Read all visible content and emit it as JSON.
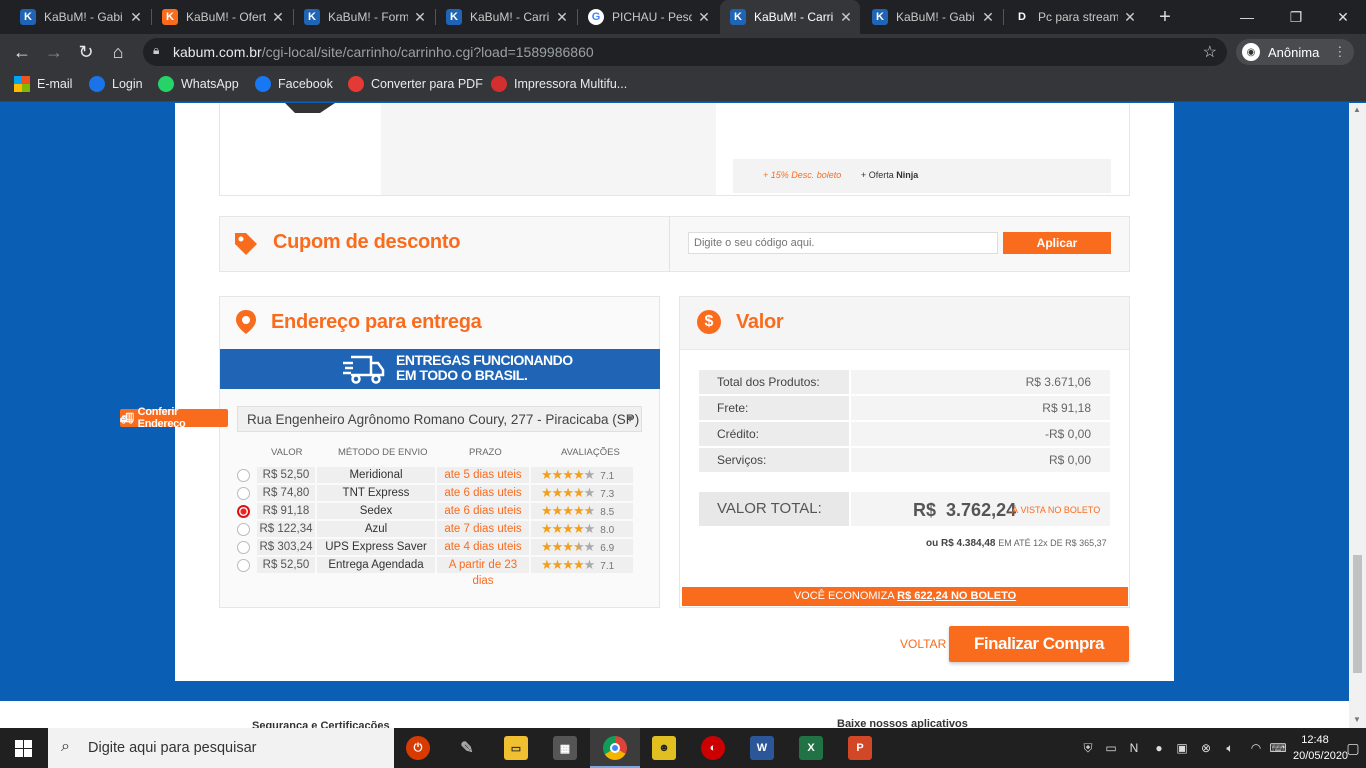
{
  "browser": {
    "tabs": [
      {
        "title": "KaBuM! - Gabi",
        "icon": "kabum-icon",
        "active": false
      },
      {
        "title": "KaBuM! - Ofert",
        "icon": "kabum-offer-icon",
        "active": false
      },
      {
        "title": "KaBuM! - Form",
        "icon": "kabum-icon",
        "active": false
      },
      {
        "title": "KaBuM! - Carri",
        "icon": "kabum-icon",
        "active": false
      },
      {
        "title": "PICHAU - Pesq",
        "icon": "google-icon",
        "active": false
      },
      {
        "title": "KaBuM! - Carri",
        "icon": "kabum-icon",
        "active": true
      },
      {
        "title": "KaBuM! - Gabi",
        "icon": "kabum-icon",
        "active": false
      },
      {
        "title": "Pc para stream",
        "icon": "dell-icon",
        "active": false
      }
    ],
    "new_tab": "+",
    "url_host": "kabum.com.br",
    "url_path": "/cgi-local/site/carrinho/carrinho.cgi?load=1589986860",
    "profile": "Anônima",
    "bookmarks": [
      {
        "label": "E-mail",
        "icon": "microsoft-icon"
      },
      {
        "label": "Login",
        "icon": "login-icon"
      },
      {
        "label": "WhatsApp",
        "icon": "whatsapp-icon"
      },
      {
        "label": "Facebook",
        "icon": "facebook-icon"
      },
      {
        "label": "Converter para PDF",
        "icon": "heart-icon"
      },
      {
        "label": "Impressora Multifu...",
        "icon": "store-icon"
      }
    ]
  },
  "product": {
    "boleto_discount": "+ 15% Desc. boleto",
    "offer_prefix": "+ Oferta",
    "offer_name": "Ninja"
  },
  "coupon": {
    "title": "Cupom de desconto",
    "placeholder": "Digite o seu código aqui.",
    "apply": "Aplicar"
  },
  "delivery": {
    "title": "Endereço para entrega",
    "banner_line1": "ENTREGAS FUNCIONANDO",
    "banner_line2": "EM TODO O BRASIL.",
    "check_address": "Conferir Endereço",
    "address": "Rua Engenheiro Agrônomo Romano Coury, 277 - Piracicaba (SP)",
    "headers": {
      "valor": "VALOR",
      "metodo": "MÉTODO DE ENVIO",
      "prazo": "PRAZO",
      "avaliacoes": "AVALIAÇÕES"
    },
    "options": [
      {
        "price": "R$ 52,50",
        "method": "Meridional",
        "deadline": "ate 5 dias uteis",
        "rating": "7.1",
        "stars": 4,
        "selected": false
      },
      {
        "price": "R$ 74,80",
        "method": "TNT Express",
        "deadline": "ate 6 dias uteis",
        "rating": "7.3",
        "stars": 4,
        "selected": false
      },
      {
        "price": "R$ 91,18",
        "method": "Sedex",
        "deadline": "ate 6 dias uteis",
        "rating": "8.5",
        "stars": 4.5,
        "selected": true
      },
      {
        "price": "R$ 122,34",
        "method": "Azul",
        "deadline": "ate 7 dias uteis",
        "rating": "8.0",
        "stars": 4,
        "selected": false
      },
      {
        "price": "R$ 303,24",
        "method": "UPS Express Saver",
        "deadline": "ate 4 dias uteis",
        "rating": "6.9",
        "stars": 3.5,
        "selected": false
      },
      {
        "price": "R$ 52,50",
        "method": "Entrega Agendada",
        "deadline": "A partir de 23 dias",
        "rating": "7.1",
        "stars": 4,
        "selected": false
      }
    ]
  },
  "valor": {
    "title": "Valor",
    "rows": [
      {
        "label": "Total dos Produtos:",
        "value": "R$ 3.671,06"
      },
      {
        "label": "Frete:",
        "value": "R$ 91,18"
      },
      {
        "label": "Crédito:",
        "value": "-R$ 0,00"
      },
      {
        "label": "Serviços:",
        "value": "R$ 0,00"
      }
    ],
    "total_label": "VALOR TOTAL:",
    "total_currency": "R$",
    "total_value": "3.762,24",
    "total_note": "À VISTA NO BOLETO",
    "installment_prefix": "ou R$ 4.384,48",
    "installment_note": "EM ATÉ 12x DE R$ 365,37",
    "savings_prefix": "VOCÊ ECONOMIZA",
    "savings_value": "R$ 622,24 NO BOLETO"
  },
  "actions": {
    "back": "VOLTAR",
    "checkout": "Finalizar Compra"
  },
  "footer": {
    "left": "Segurança e Certificações",
    "right": "Baixe nossos aplicativos"
  },
  "taskbar": {
    "search_placeholder": "Digite aqui para pesquisar",
    "time": "12:48",
    "date": "20/05/2020"
  }
}
